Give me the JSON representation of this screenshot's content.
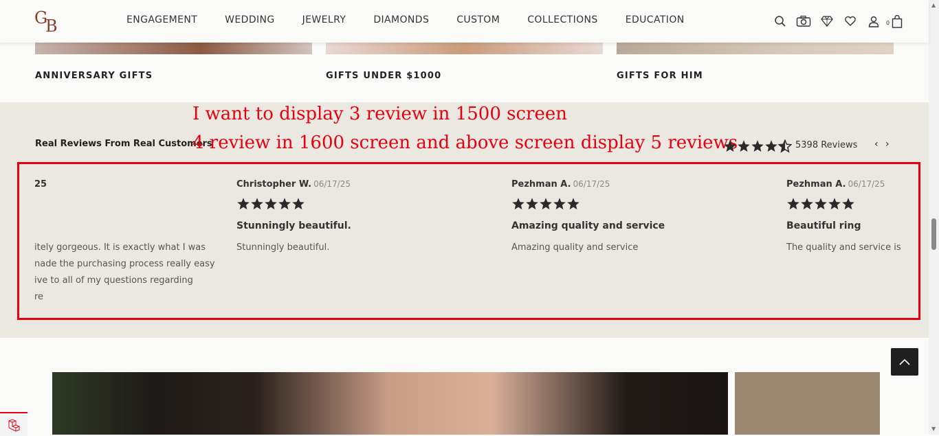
{
  "header": {
    "logo_g": "G",
    "logo_b": "B",
    "nav": [
      "ENGAGEMENT",
      "WEDDING",
      "JEWELRY",
      "DIAMONDS",
      "CUSTOM",
      "COLLECTIONS",
      "EDUCATION"
    ],
    "cart_count": "0"
  },
  "gifts": [
    "ANNIVERSARY GIFTS",
    "GIFTS UNDER $1000",
    "GIFTS FOR HIM"
  ],
  "reviews": {
    "title": "Real Reviews From Real Customers",
    "annotation_line1": "I want to display 3 review in 1500 screen",
    "annotation_line2": "4 review in 1600 screen and above screen display 5 reviews",
    "average_rating": 4.5,
    "count_label": "5398 Reviews",
    "prev": "‹",
    "next": "›",
    "cards": [
      {
        "name": "",
        "date": "25",
        "headline": "",
        "body": [
          "itely gorgeous. It is exactly what I was",
          "nade the purchasing process really easy",
          "ive to all of my questions regarding",
          "re"
        ],
        "stars": 0
      },
      {
        "name": "Christopher W.",
        "date": "06/17/25",
        "headline": "Stunningly beautiful.",
        "body": [
          "Stunningly beautiful."
        ],
        "stars": 5
      },
      {
        "name": "Pezhman A.",
        "date": "06/17/25",
        "headline": "Amazing quality and service",
        "body": [
          "Amazing quality and service"
        ],
        "stars": 5
      },
      {
        "name": "Pezhman A.",
        "date": "06/17/25",
        "headline": "Beautiful ring",
        "body": [
          "The quality and service is"
        ],
        "stars": 5
      }
    ]
  },
  "colors": {
    "brand": "#8b3a2e",
    "annotation_red": "#e8000e",
    "reviews_bg": "#ebe8e1",
    "star": "#2b2b2b"
  },
  "icons": [
    "search-icon",
    "camera-icon",
    "diamond-icon",
    "heart-icon",
    "user-icon",
    "bag-icon",
    "chevron-up-icon",
    "laravel-icon"
  ]
}
